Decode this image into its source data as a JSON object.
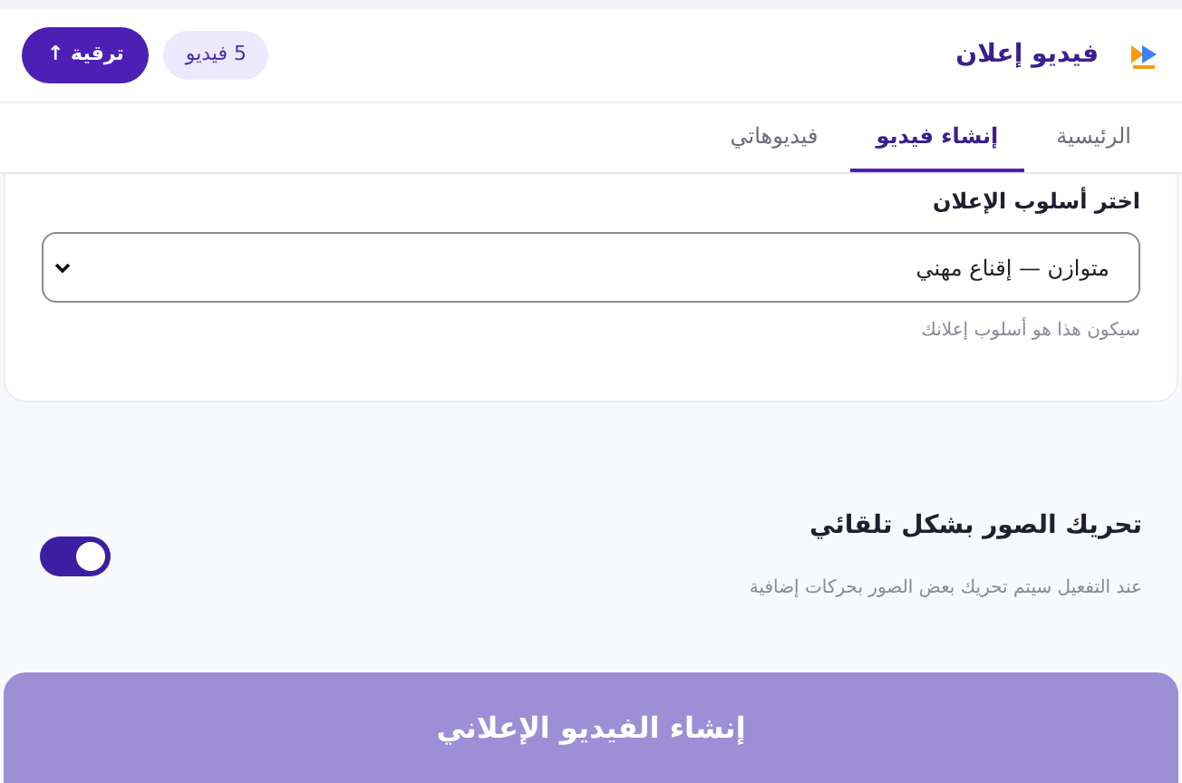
{
  "header": {
    "title": "فيديو إعلان",
    "credits": "5 فيديو",
    "upgrade_button": "ترقية ↑"
  },
  "tabs": [
    {
      "label": "الرئيسية",
      "selected": false
    },
    {
      "label": "إنشاء فيديو",
      "selected": true
    },
    {
      "label": "فيديوهاتي",
      "selected": false
    }
  ],
  "style_section": {
    "label": "اختر أسلوب الإعلان",
    "value": "متوازن — إقناع مهني",
    "hint": "سيكون هذا هو أسلوب إعلانك"
  },
  "animate_option": {
    "label": "تحريك الصور بشكل تلقائي",
    "description": "عند التفعيل سيتم تحريك بعض الصور بحركات إضافية",
    "on": true
  },
  "create_button": {
    "label": "إنشاء الفيديو الإعلاني",
    "disabled": true
  }
}
